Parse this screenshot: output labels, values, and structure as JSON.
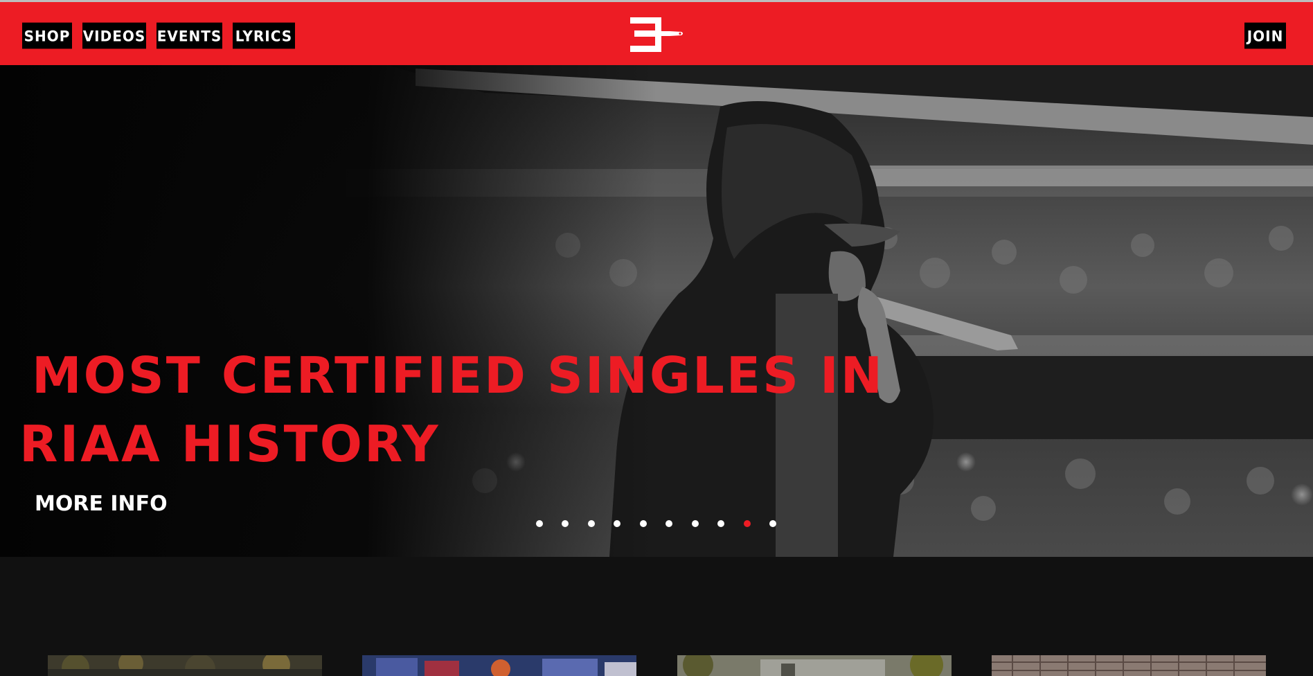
{
  "header": {
    "nav": [
      {
        "label": "SHOP"
      },
      {
        "label": "VIDEOS"
      },
      {
        "label": "EVENTS"
      },
      {
        "label": "LYRICS"
      }
    ],
    "join_label": "JOIN",
    "logo_icon": "eminem-knife-logo"
  },
  "hero": {
    "headline_line1": "MOST CERTIFIED SINGLES IN",
    "headline_line2": "RIAA HISTORY",
    "more_info_label": "MORE INFO",
    "slide_count": 10,
    "active_slide": 9,
    "image": "performer-with-microphone-stadium"
  },
  "colors": {
    "brand_red": "#ed1c24",
    "nav_bg": "#000000",
    "page_bg": "#111111"
  },
  "thumbnails": [
    {
      "image": "trees-photo"
    },
    {
      "image": "colorful-graffiti-photo"
    },
    {
      "image": "trees-building-photo"
    },
    {
      "image": "building-facade-photo"
    }
  ]
}
